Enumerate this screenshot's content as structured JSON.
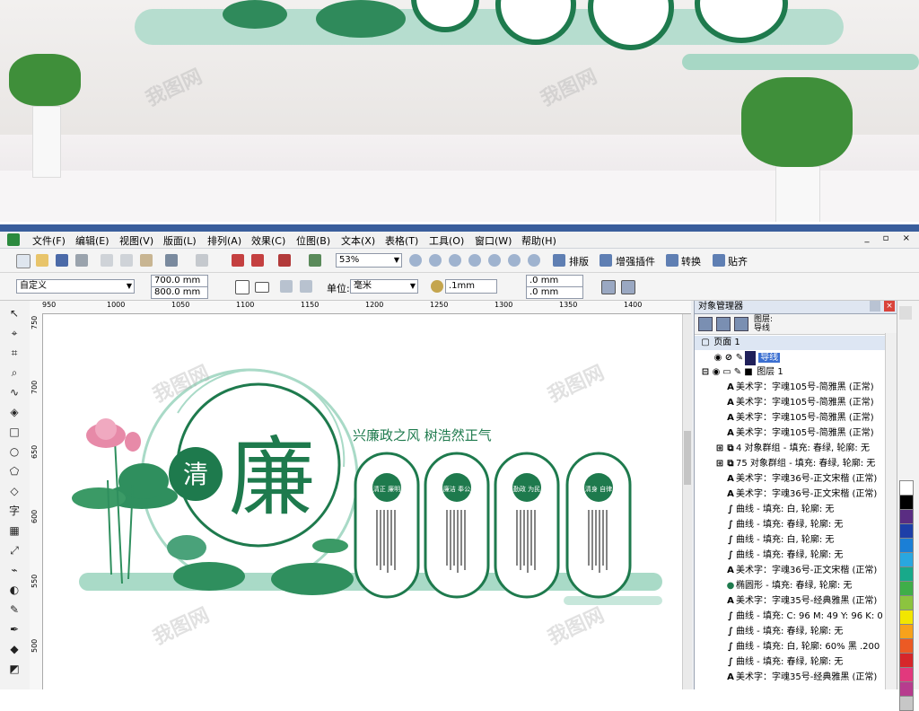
{
  "menu": [
    "文件(F)",
    "编辑(E)",
    "视图(V)",
    "版面(L)",
    "排列(A)",
    "效果(C)",
    "位图(B)",
    "文本(X)",
    "表格(T)",
    "工具(O)",
    "窗口(W)",
    "帮助(H)"
  ],
  "toolbar": {
    "zoom": "53%",
    "buttons": [
      "排版",
      "增强插件",
      "转换",
      "贴齐"
    ]
  },
  "propbar": {
    "page_preset": "自定义",
    "width": "700.0 mm",
    "height": "800.0 mm",
    "unit_label": "单位:",
    "unit_value": "毫米",
    "nudge": ".1mm",
    "dup_x": ".0 mm",
    "dup_y": ".0 mm"
  },
  "ruler": {
    "h": [
      "950",
      "1000",
      "1050",
      "1100",
      "1150",
      "1200",
      "1250",
      "1300",
      "1350",
      "1400"
    ],
    "v": [
      "750",
      "700",
      "650",
      "600",
      "550",
      "500"
    ]
  },
  "design": {
    "slogan": "兴廉政之风  树浩然正气",
    "char_small": "清",
    "char_big": "廉",
    "panels": [
      "清正\n廉明",
      "廉洁\n奉公",
      "勤政\n为民",
      "清身\n自律"
    ]
  },
  "object_manager": {
    "title": "对象管理器",
    "layer_label": "图层:",
    "layer_value": "导线",
    "page": "页面 1",
    "guide_layer": "导线",
    "layer1": "图层 1",
    "items": [
      "美术字：字魂105号-简雅黑 (正常)",
      "美术字：字魂105号-简雅黑 (正常)",
      "美术字：字魂105号-简雅黑 (正常)",
      "美术字：字魂105号-简雅黑 (正常)",
      "4 对象群组 - 填充: 春绿, 轮廓: 无",
      "75 对象群组 - 填充: 春绿, 轮廓: 无",
      "美术字：字魂36号-正文宋楷 (正常)",
      "美术字：字魂36号-正文宋楷 (正常)",
      "曲线 - 填充: 白, 轮廓: 无",
      "曲线 - 填充: 春绿, 轮廓: 无",
      "曲线 - 填充: 白, 轮廓: 无",
      "曲线 - 填充: 春绿, 轮廓: 无",
      "美术字：字魂36号-正文宋楷 (正常)",
      "椭圆形 - 填充: 春绿, 轮廓: 无",
      "美术字：字魂35号-经典雅黑 (正常)",
      "曲线 - 填充: C: 96 M: 49 Y: 96 K: 0",
      "曲线 - 填充: 春绿, 轮廓: 无",
      "曲线 - 填充: 白, 轮廓: 60% 黑 .200",
      "曲线 - 填充: 春绿, 轮廓: 无",
      "美术字：字魂35号-经典雅黑 (正常)"
    ]
  },
  "colors": {
    "accent": "#1e7a4d",
    "mint": "#a9dac7",
    "pink": "#e78aa8"
  },
  "palette": [
    "#ffffff",
    "#000000",
    "#5a2d82",
    "#1d3fa8",
    "#1b7fd6",
    "#29a7e0",
    "#18a98a",
    "#3fae49",
    "#8cc43f",
    "#f2e600",
    "#f7a21b",
    "#ec5a24",
    "#d6262a",
    "#e2397d",
    "#b73c8e",
    "#c7c7c7"
  ]
}
